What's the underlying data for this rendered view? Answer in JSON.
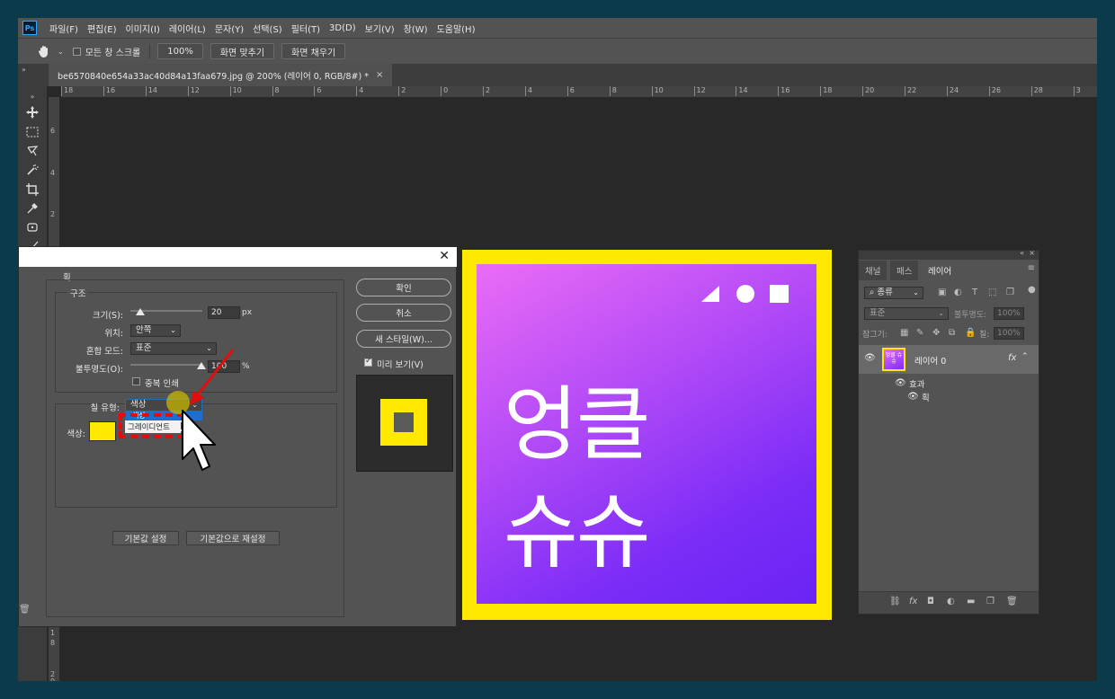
{
  "app": {
    "logo": "Ps"
  },
  "menu": [
    "파일(F)",
    "편집(E)",
    "이미지(I)",
    "레이어(L)",
    "문자(Y)",
    "선택(S)",
    "필터(T)",
    "3D(D)",
    "보기(V)",
    "창(W)",
    "도움말(H)"
  ],
  "options": {
    "scroll_all_label": "모든 창 스크롤",
    "zoom_label": "100%",
    "fit_screen_label": "화면 맞추기",
    "fill_screen_label": "화면 채우기"
  },
  "tab": {
    "title": "be6570840e654a33ac40d84a13faa679.jpg @ 200% (레이어 0, RGB/8#) *",
    "close": "×"
  },
  "ruler_top": [
    "18",
    "16",
    "14",
    "12",
    "10",
    "8",
    "6",
    "4",
    "2",
    "0",
    "2",
    "4",
    "6",
    "8",
    "10",
    "12",
    "14",
    "16",
    "18",
    "20",
    "22",
    "24",
    "26",
    "28",
    "3"
  ],
  "ruler_left": [
    "6",
    "4",
    "2",
    "1",
    "8",
    "2",
    "0"
  ],
  "artwork": {
    "line1": "엉클",
    "line2": "슈슈"
  },
  "dialog": {
    "title_section": "획",
    "structure_legend": "구조",
    "size_label": "크기(S):",
    "size_value": "20",
    "size_unit": "px",
    "position_label": "위치:",
    "position_value": "안쪽",
    "blend_label": "혼합 모드:",
    "blend_value": "표준",
    "opacity_label": "불투명도(O):",
    "opacity_value": "100",
    "opacity_unit": "%",
    "overprint_label": "중복 인쇄",
    "fill_type_label": "칠 유형:",
    "fill_type_value": "색상",
    "dropdown_option_color": "색상",
    "dropdown_option_gradient": "그레이디언트",
    "color_label": "색상:",
    "stroke_color": "#ffe900",
    "make_default_label": "기본값 설정",
    "reset_default_label": "기본값으로 재설정",
    "ok_label": "확인",
    "cancel_label": "취소",
    "new_style_label": "새 스타일(W)...",
    "preview_label": "미리 보기(V)"
  },
  "layers_panel": {
    "tabs": [
      "채널",
      "패스",
      "레이어"
    ],
    "filter_kind": "종류",
    "blend_mode": "표준",
    "opacity_label": "불투명도:",
    "opacity_value": "100%",
    "lock_label": "잠그기:",
    "fill_label": "칠:",
    "fill_value": "100%",
    "layer_name": "레이어 0",
    "effects_label": "효과",
    "stroke_effect": "획",
    "thumb_text": "엉클 슈슈",
    "fx_label": "fx"
  }
}
